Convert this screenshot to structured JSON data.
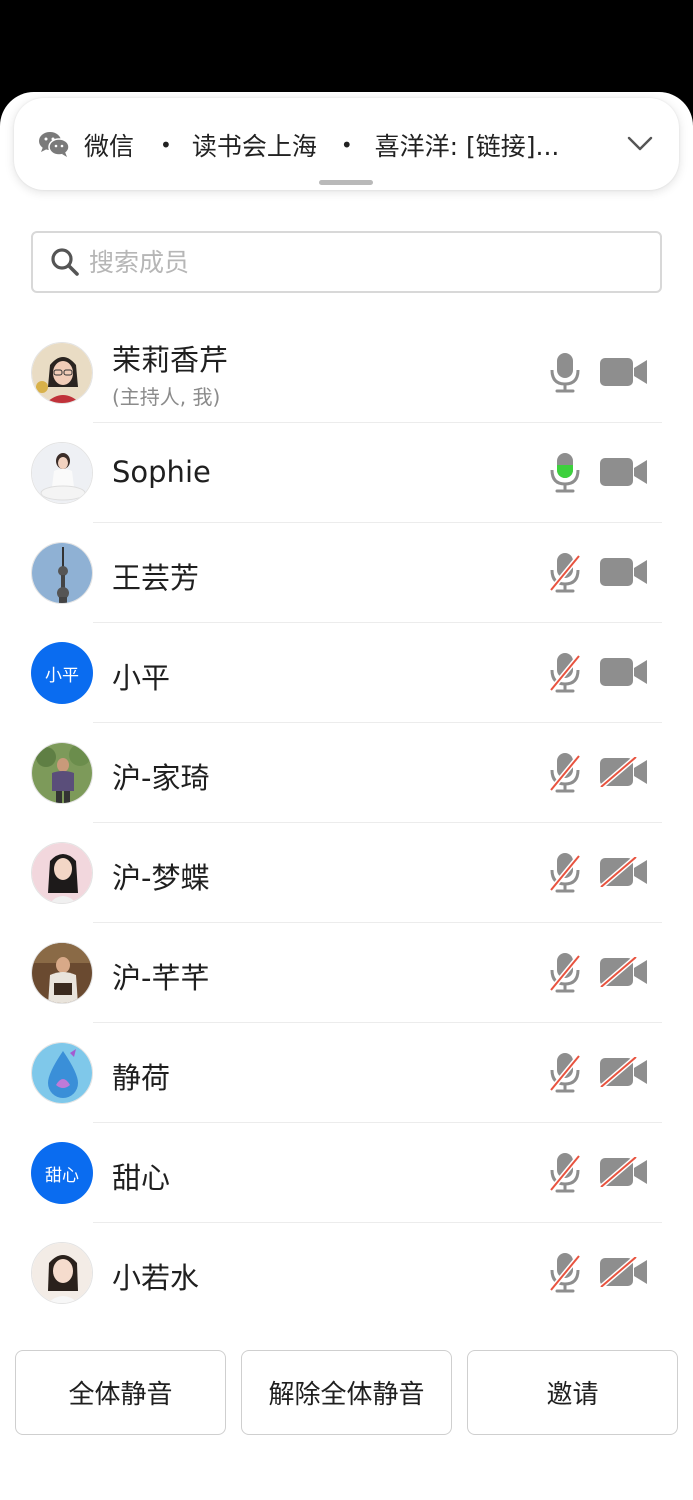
{
  "banner": {
    "app": "微信",
    "group": "读书会上海",
    "message": "喜洋洋: [链接]..."
  },
  "search": {
    "placeholder": "搜索成员"
  },
  "members": [
    {
      "name": "茉莉香芹",
      "sub": "(主持人, 我)",
      "mic": "on",
      "cam": "on",
      "avatar": "photo"
    },
    {
      "name": "Sophie",
      "mic": "speaking",
      "cam": "on",
      "avatar": "photo"
    },
    {
      "name": "王芸芳",
      "mic": "muted",
      "cam": "on",
      "avatar": "photo"
    },
    {
      "name": "小平",
      "mic": "muted",
      "cam": "on",
      "avatar_text": "小平"
    },
    {
      "name": "沪-家琦",
      "mic": "muted",
      "cam": "off",
      "avatar": "photo"
    },
    {
      "name": "沪-梦蝶",
      "mic": "muted",
      "cam": "off",
      "avatar": "photo"
    },
    {
      "name": "沪-芊芊",
      "mic": "muted",
      "cam": "off",
      "avatar": "photo"
    },
    {
      "name": "静荷",
      "mic": "muted",
      "cam": "off",
      "avatar": "photo"
    },
    {
      "name": "甜心",
      "mic": "muted",
      "cam": "off",
      "avatar_text": "甜心"
    },
    {
      "name": "小若水",
      "mic": "muted",
      "cam": "off",
      "avatar": "photo"
    }
  ],
  "actions": {
    "mute_all": "全体静音",
    "unmute_all": "解除全体静音",
    "invite": "邀请"
  },
  "colors": {
    "icon_gray": "#8e8e8e",
    "speaking_green": "#3dd13d",
    "muted_red": "#e8533f",
    "text_avatar_blue": "#0a6cf0"
  }
}
